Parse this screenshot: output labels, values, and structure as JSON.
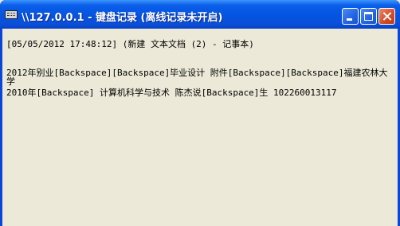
{
  "window": {
    "title": "\\\\127.0.0.1 - 键盘记录 (离线记录未开启)"
  },
  "log": {
    "lines": [
      "[05/05/2012 17:48:12] (新建 文本文档 (2) - 记事本)",
      "2012年别业[Backspace][Backspace]毕业设计 附件[Backspace][Backspace]福建农林大",
      "学",
      "2010年[Backspace] 计算机科学与技术 陈杰说[Backspace]生 102260013117"
    ]
  }
}
